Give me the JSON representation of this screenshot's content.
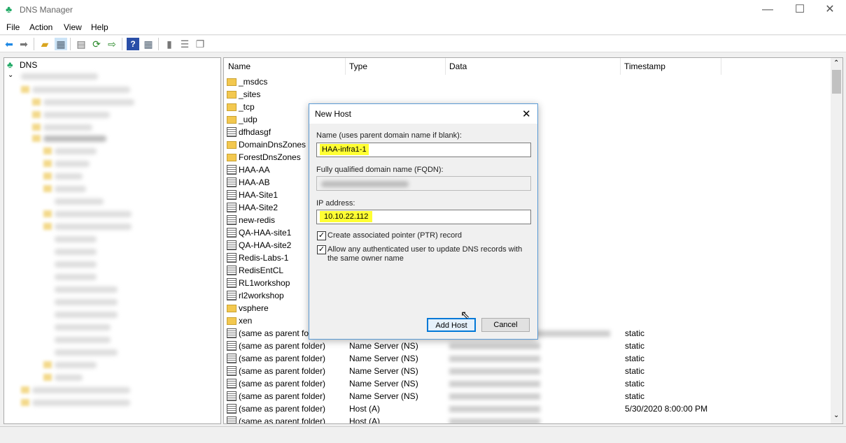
{
  "window": {
    "title": "DNS Manager",
    "icon": "dns-server-icon",
    "minimize": "—",
    "maximize": "☐",
    "close": "✕"
  },
  "menu": [
    "File",
    "Action",
    "View",
    "Help"
  ],
  "toolbar": [
    "back-arrow-icon",
    "forward-arrow-icon",
    "up-folder-icon",
    "show-hide-tree-icon",
    "properties-icon",
    "refresh-icon",
    "export-list-icon",
    "help-icon",
    "show-action-pane-icon",
    "server-icon",
    "list-icon",
    "copy-icon"
  ],
  "tree": {
    "root": "DNS"
  },
  "columns": [
    "Name",
    "Type",
    "Data",
    "Timestamp"
  ],
  "rows": [
    {
      "name": "_msdcs",
      "icon": "folder",
      "type": "",
      "ts": ""
    },
    {
      "name": "_sites",
      "icon": "folder",
      "type": "",
      "ts": ""
    },
    {
      "name": "_tcp",
      "icon": "folder",
      "type": "",
      "ts": ""
    },
    {
      "name": "_udp",
      "icon": "folder",
      "type": "",
      "ts": ""
    },
    {
      "name": "dfhdasgf",
      "icon": "record",
      "type": "",
      "ts": ""
    },
    {
      "name": "DomainDnsZones",
      "icon": "folder",
      "type": "",
      "ts": ""
    },
    {
      "name": "ForestDnsZones",
      "icon": "folder",
      "type": "",
      "ts": ""
    },
    {
      "name": "HAA-AA",
      "icon": "record",
      "type": "",
      "ts": ""
    },
    {
      "name": "HAA-AB",
      "icon": "record",
      "type": "",
      "ts": ""
    },
    {
      "name": "HAA-Site1",
      "icon": "record",
      "type": "",
      "ts": ""
    },
    {
      "name": "HAA-Site2",
      "icon": "record",
      "type": "",
      "ts": ""
    },
    {
      "name": "new-redis",
      "icon": "record",
      "type": "",
      "ts": ""
    },
    {
      "name": "QA-HAA-site1",
      "icon": "record",
      "type": "",
      "ts": ""
    },
    {
      "name": "QA-HAA-site2",
      "icon": "record",
      "type": "",
      "ts": ""
    },
    {
      "name": "Redis-Labs-1",
      "icon": "record",
      "type": "",
      "ts": ""
    },
    {
      "name": "RedisEntCL",
      "icon": "record",
      "type": "",
      "ts": ""
    },
    {
      "name": "RL1workshop",
      "icon": "record",
      "type": "",
      "ts": ""
    },
    {
      "name": "rl2workshop",
      "icon": "record",
      "type": "",
      "ts": ""
    },
    {
      "name": "vsphere",
      "icon": "folder",
      "type": "",
      "ts": ""
    },
    {
      "name": "xen",
      "icon": "folder",
      "type": "",
      "ts": ""
    },
    {
      "name": "(same as parent folder)",
      "icon": "record",
      "type": "",
      "ts": "static",
      "blurred": true
    },
    {
      "name": "(same as parent folder)",
      "icon": "record",
      "type": "Name Server (NS)",
      "ts": "static",
      "blurred": true
    },
    {
      "name": "(same as parent folder)",
      "icon": "record",
      "type": "Name Server (NS)",
      "ts": "static",
      "blurred": true
    },
    {
      "name": "(same as parent folder)",
      "icon": "record",
      "type": "Name Server (NS)",
      "ts": "static",
      "blurred": true
    },
    {
      "name": "(same as parent folder)",
      "icon": "record",
      "type": "Name Server (NS)",
      "ts": "static",
      "blurred": true
    },
    {
      "name": "(same as parent folder)",
      "icon": "record",
      "type": "Name Server (NS)",
      "ts": "static",
      "blurred": true
    },
    {
      "name": "(same as parent folder)",
      "icon": "record",
      "type": "Host (A)",
      "ts": "5/30/2020 8:00:00 PM",
      "blurred": true
    },
    {
      "name": "(same as parent folder)",
      "icon": "record",
      "type": "Host (A)",
      "ts": "",
      "blurred": true
    }
  ],
  "dialog": {
    "title": "New Host",
    "close": "✕",
    "name_label": "Name (uses parent domain name if blank):",
    "name_value": "HAA-infra1-1",
    "fqdn_label": "Fully qualified domain name (FQDN):",
    "ip_label": "IP address:",
    "ip_value": "10.10.22.112",
    "ptr_label": "Create associated pointer (PTR) record",
    "ptr_checked": true,
    "allow_label": "Allow any authenticated user to update DNS records with the same owner name",
    "allow_checked": true,
    "add_label": "Add Host",
    "cancel_label": "Cancel",
    "check": "✓"
  },
  "colors": {
    "highlight": "#ffff33",
    "accent": "#0078d7"
  }
}
